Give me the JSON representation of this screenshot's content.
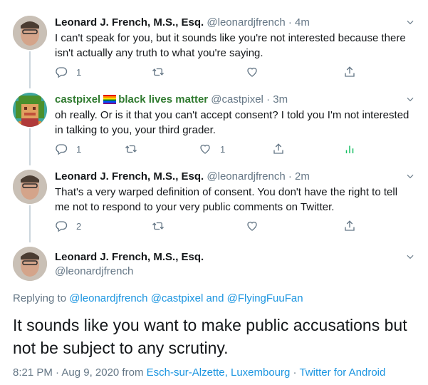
{
  "tweets": [
    {
      "name": "Leonard J. French, M.S., Esq.",
      "handle": "@leonardjfrench",
      "sep": "·",
      "time": "4m",
      "text": "I can't speak for you, but it sounds like you're not interested because there isn't actually any truth to what you're saying.",
      "reply_count": "1",
      "like_count": ""
    },
    {
      "name": "castpixel",
      "name_suffix": "black lives matter",
      "handle": "@castpixel",
      "sep": "·",
      "time": "3m",
      "text": "oh really. Or is it that you can't accept consent? I told you I'm not interested in talking to you, your third grader.",
      "reply_count": "1",
      "like_count": "1"
    },
    {
      "name": "Leonard J. French, M.S., Esq.",
      "handle": "@leonardjfrench",
      "sep": "·",
      "time": "2m",
      "text": "That's a very warped definition of consent. You don't have the right to tell me not to respond to your very public comments on Twitter.",
      "reply_count": "2",
      "like_count": ""
    }
  ],
  "main_tweet": {
    "name": "Leonard J. French, M.S., Esq.",
    "handle": "@leonardjfrench",
    "replying_prefix": "Replying to",
    "replying_1": "@leonardjfrench",
    "replying_2": "@castpixel",
    "replying_and": "and",
    "replying_3": "@FlyingFuuFan",
    "text": "It sounds like you want to make public accusations but not be subject to any scrutiny.",
    "timestamp": "8:21 PM · Aug 9, 2020 from",
    "location": "Esch-sur-Alzette, Luxembourg",
    "sep": "·",
    "client": "Twitter for Android"
  },
  "colors": {
    "link": "#1b95e0",
    "muted": "#657786",
    "castpixel_green": "#2f7a2f"
  }
}
